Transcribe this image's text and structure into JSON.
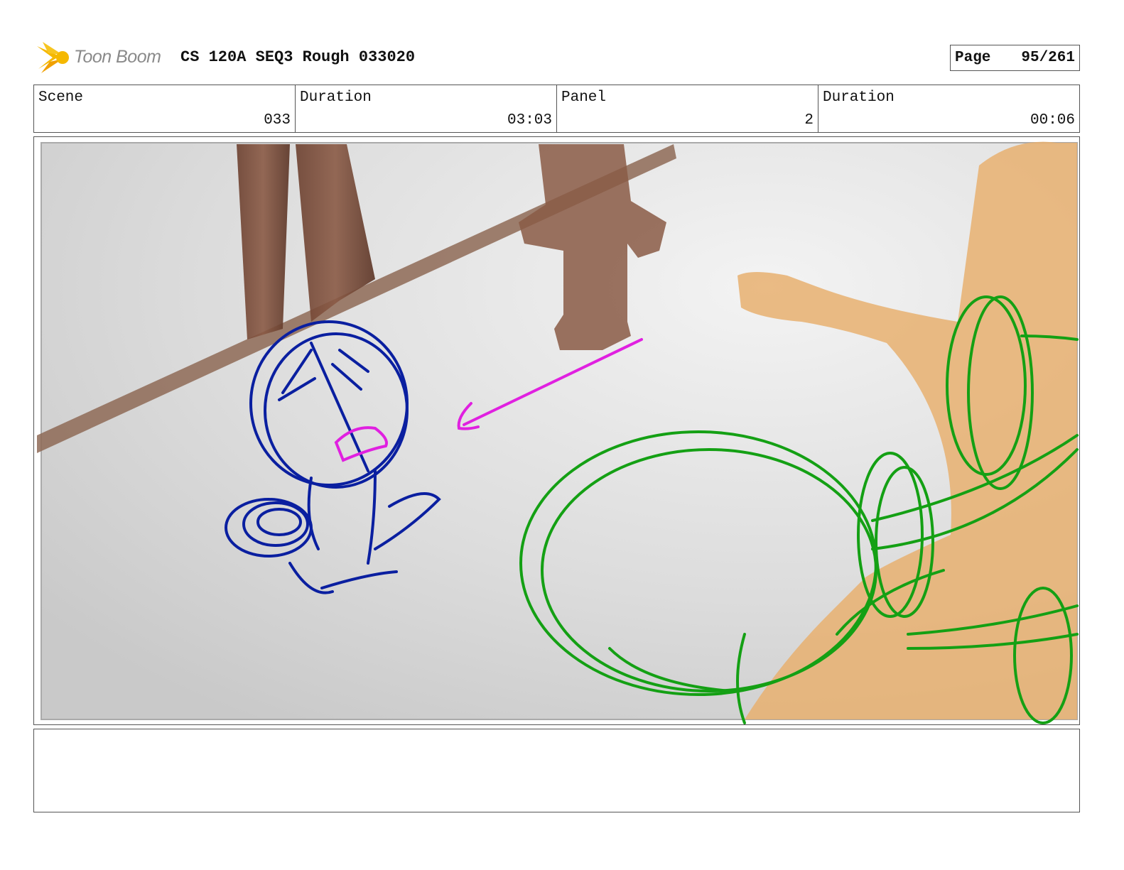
{
  "header": {
    "logo_text": "Toon Boom",
    "title": "CS 120A SEQ3 Rough 033020",
    "page_label": "Page",
    "page_value": "95/261"
  },
  "info": {
    "scene_label": "Scene",
    "scene_value": "033",
    "scene_duration_label": "Duration",
    "scene_duration_value": "03:03",
    "panel_label": "Panel",
    "panel_value": "2",
    "panel_duration_label": "Duration",
    "panel_duration_value": "00:06"
  },
  "notes": {
    "text": ""
  },
  "colors": {
    "logo_yellow": "#f5b800",
    "sketch_blue": "#0a1fa0",
    "sketch_magenta": "#e020e0",
    "sketch_green": "#14a014",
    "character_orange": "#e8b070",
    "railing_brown": "#7a4a30"
  }
}
